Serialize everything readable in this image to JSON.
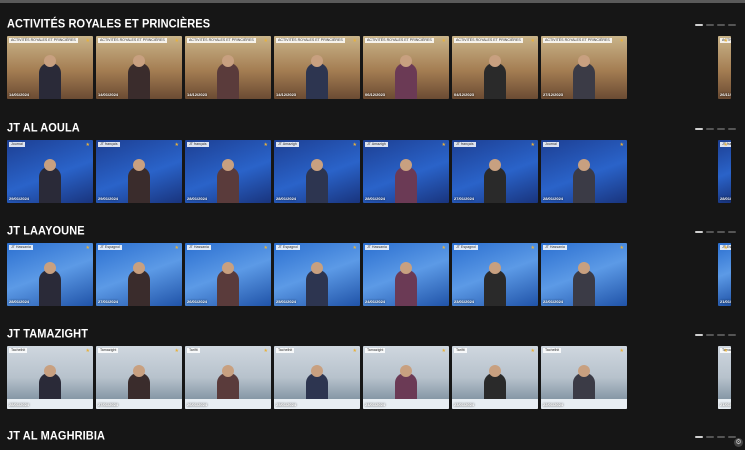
{
  "sections": [
    {
      "title": "ACTIVITÉS ROYALES ET PRINCIÈRES",
      "style": "roy",
      "thumbs": [
        {
          "badge": "ACTIVITÉS ROYALES ET PRINCIÈRES",
          "date": "14/01/2024"
        },
        {
          "badge": "ACTIVITÉS ROYALES ET PRINCIÈRES",
          "date": "14/01/2024"
        },
        {
          "badge": "ACTIVITÉS ROYALES ET PRINCIÈRES",
          "date": "14/12/2023"
        },
        {
          "badge": "ACTIVITÉS ROYALES ET PRINCIÈRES",
          "date": "14/12/2023"
        },
        {
          "badge": "ACTIVITÉS ROYALES ET PRINCIÈRES",
          "date": "06/12/2023"
        },
        {
          "badge": "ACTIVITÉS ROYALES ET PRINCIÈRES",
          "date": "04/12/2023"
        },
        {
          "badge": "ACTIVITÉS ROYALES ET PRINCIÈRES",
          "date": "27/12/2023"
        },
        {
          "badge": "ACTIVITÉS ROYALES ET PRINCIÈRES",
          "date": "26/11/2023"
        }
      ]
    },
    {
      "title": "JT AL AOULA",
      "style": "aoula",
      "thumbs": [
        {
          "badge": "Journal",
          "date": "29/01/2024"
        },
        {
          "badge": "JT français",
          "date": "29/01/2024"
        },
        {
          "badge": "JT français",
          "date": "28/01/2024"
        },
        {
          "badge": "JT Amazigh",
          "date": "28/01/2024"
        },
        {
          "badge": "JT Amazigh",
          "date": "28/01/2024"
        },
        {
          "badge": "JT français",
          "date": "27/01/2024"
        },
        {
          "badge": "Journal",
          "date": "28/01/2024"
        },
        {
          "badge": "JT français",
          "date": "28/01/2024"
        }
      ]
    },
    {
      "title": "JT LAAYOUNE",
      "style": "laay",
      "thumbs": [
        {
          "badge": "JT Hassania",
          "date": "28/01/2024"
        },
        {
          "badge": "JT Espagnol",
          "date": "27/01/2024"
        },
        {
          "badge": "JT Hassania",
          "date": "26/01/2024"
        },
        {
          "badge": "JT Espagnol",
          "date": "25/01/2024"
        },
        {
          "badge": "JT Hassania",
          "date": "24/01/2024"
        },
        {
          "badge": "JT Espagnol",
          "date": "23/01/2024"
        },
        {
          "badge": "JT Hassania",
          "date": "22/01/2024"
        },
        {
          "badge": "JT Espagnol",
          "date": "21/01/2024"
        }
      ]
    },
    {
      "title": "JT TAMAZIGHT",
      "style": "tam",
      "thumbs": [
        {
          "badge": "Tachelhit",
          "date": "28/01/2024"
        },
        {
          "badge": "Tamazight",
          "date": "27/01/2024"
        },
        {
          "badge": "Tarifit",
          "date": "26/01/2024"
        },
        {
          "badge": "Tachelhit",
          "date": "25/01/2024"
        },
        {
          "badge": "Tamazight",
          "date": "24/01/2024"
        },
        {
          "badge": "Tarifit",
          "date": "23/01/2024"
        },
        {
          "badge": "Tachelhit",
          "date": "22/01/2024"
        },
        {
          "badge": "Tamazight",
          "date": "21/01/2024"
        }
      ]
    },
    {
      "title": "JT AL MAGHRIBIA",
      "style": "mag",
      "thumbs": []
    }
  ]
}
